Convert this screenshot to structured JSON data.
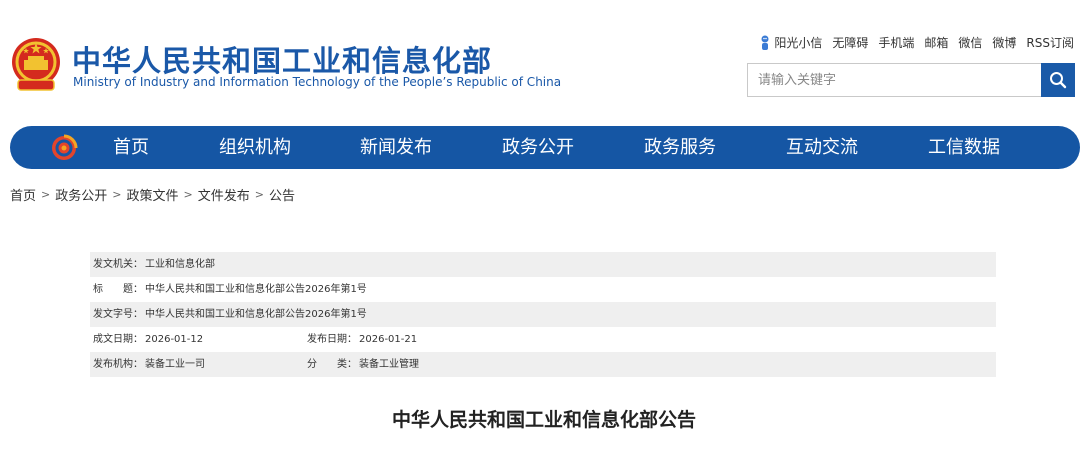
{
  "header": {
    "title_cn": "中华人民共和国工业和信息化部",
    "title_en": "Ministry of Industry and Information Technology of the People’s Republic of China",
    "toplinks": [
      "阳光小信",
      "无障碍",
      "手机端",
      "邮箱",
      "微信",
      "微博",
      "RSS订阅"
    ],
    "search_placeholder": "请输入关键字"
  },
  "nav": {
    "items": [
      "首页",
      "组织机构",
      "新闻发布",
      "政务公开",
      "政务服务",
      "互动交流",
      "工信数据"
    ]
  },
  "breadcrumb": [
    "首页",
    "政务公开",
    "政策文件",
    "文件发布",
    "公告"
  ],
  "meta": {
    "issuer_label": "发文机关：",
    "issuer": "工业和信息化部",
    "title_label": "标　　题：",
    "title": "中华人民共和国工业和信息化部公告2026年第1号",
    "docno_label": "发文字号：",
    "docno": "中华人民共和国工业和信息化部公告2026年第1号",
    "created_label": "成文日期：",
    "created": "2026-01-12",
    "published_label": "发布日期：",
    "published": "2026-01-21",
    "org_label": "发布机构：",
    "org": "装备工业一司",
    "category_label": "分　　类：",
    "category": "装备工业管理"
  },
  "document": {
    "heading": "中华人民共和国工业和信息化部公告"
  },
  "colors": {
    "brand_blue": "#1556a4",
    "title_blue": "#1a58a8",
    "row_shade": "#efefef"
  }
}
